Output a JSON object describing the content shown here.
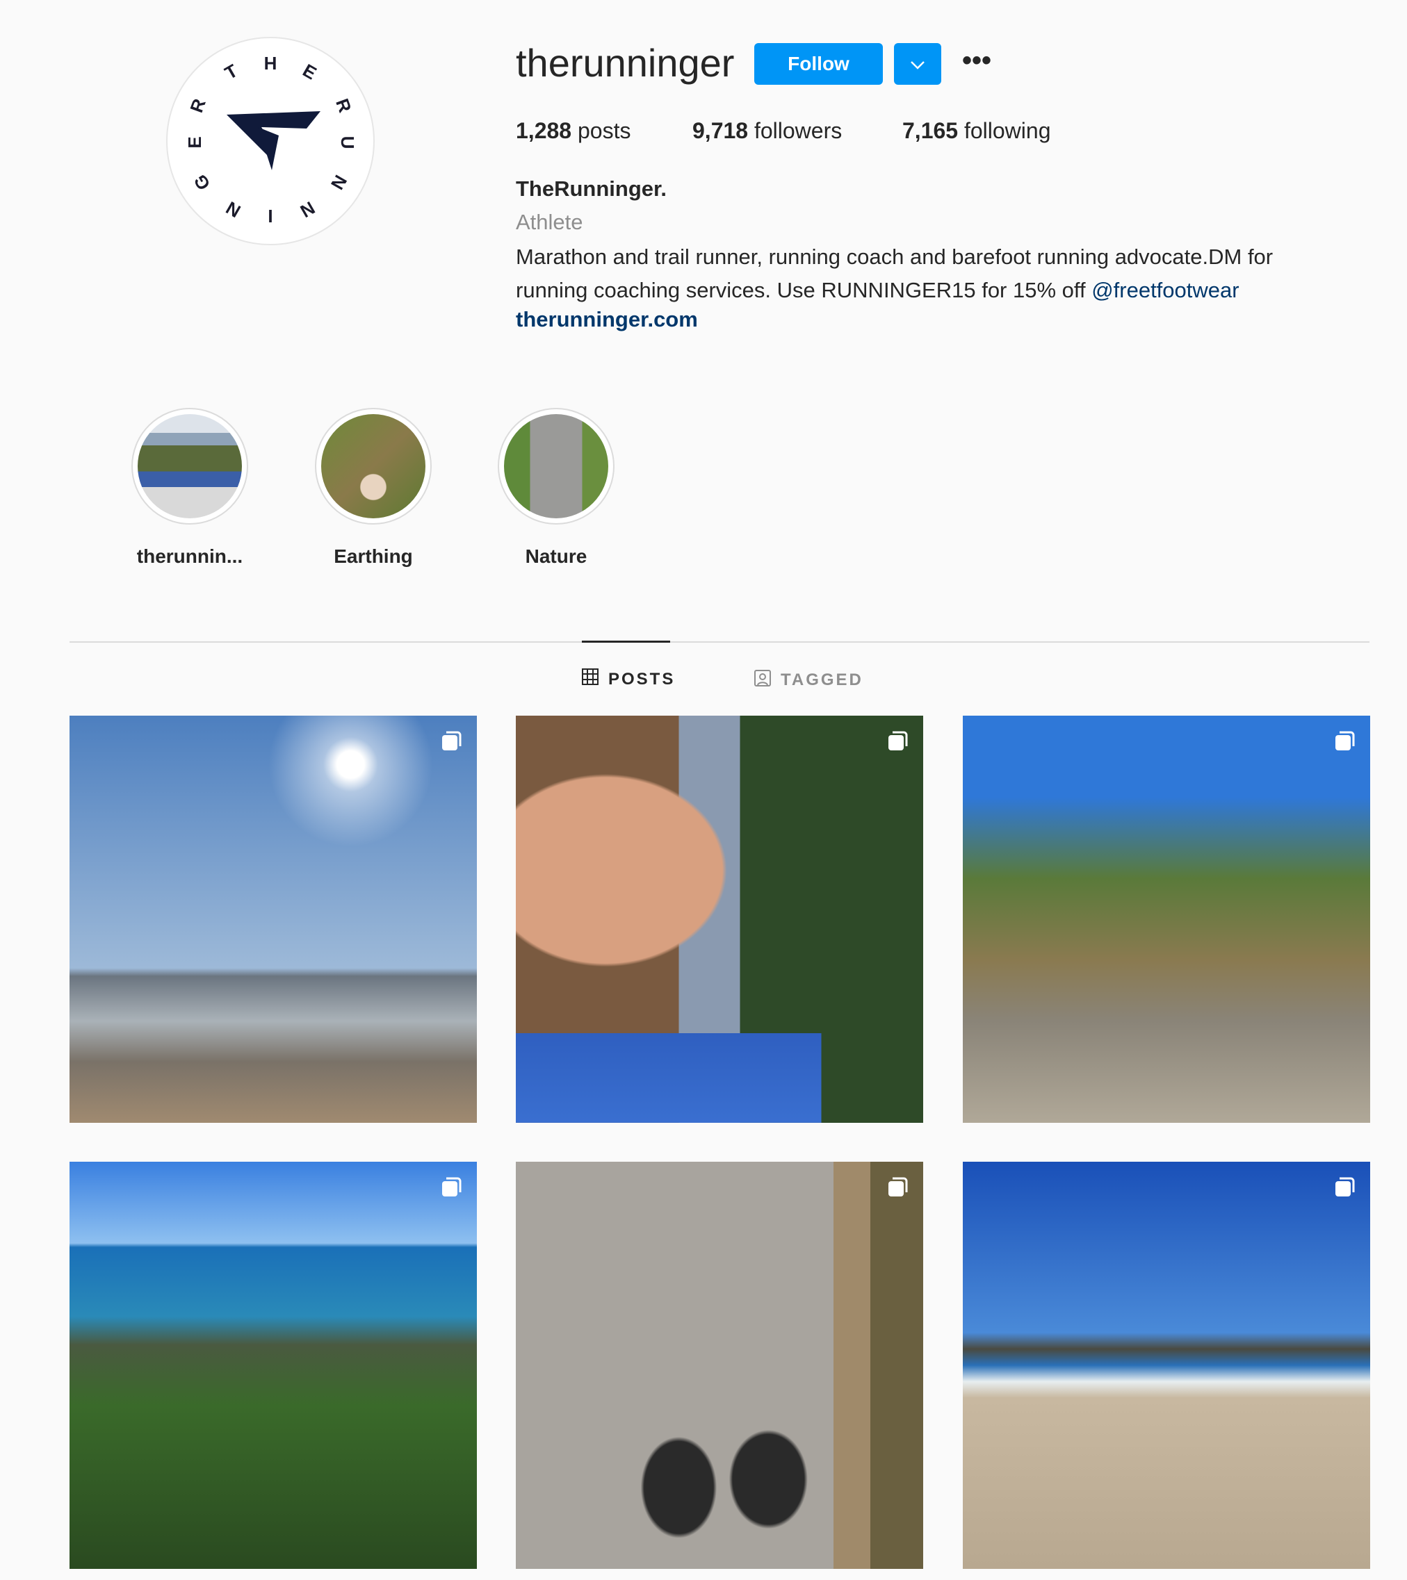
{
  "profile": {
    "username": "therunninger",
    "follow_label": "Follow",
    "posts_count": "1,288",
    "posts_label": "posts",
    "followers_count": "9,718",
    "followers_label": "followers",
    "following_count": "7,165",
    "following_label": "following",
    "display_name": "TheRunninger.",
    "category": "Athlete",
    "bio_text": "Marathon and trail runner, running coach and barefoot running advocate.DM for running coaching services. Use RUNNINGER15 for 15% off ",
    "bio_mention": "@freetfootwear",
    "website": "therunninger.com",
    "avatar_logo_text": "THE RUNNINGER"
  },
  "highlights": [
    {
      "label": "therunnin..."
    },
    {
      "label": "Earthing"
    },
    {
      "label": "Nature"
    }
  ],
  "tabs": [
    {
      "label": "POSTS",
      "icon": "grid-icon",
      "active": true
    },
    {
      "label": "TAGGED",
      "icon": "tagged-icon",
      "active": false
    }
  ],
  "posts": [
    {
      "subject": "beach-sun",
      "multi": true
    },
    {
      "subject": "selfie-coast",
      "multi": true
    },
    {
      "subject": "pandanus-rocks",
      "multi": true
    },
    {
      "subject": "ocean-headland",
      "multi": true
    },
    {
      "subject": "barefoot-shoes-start",
      "multi": true
    },
    {
      "subject": "beach-headland",
      "multi": true
    }
  ],
  "colors": {
    "accent": "#0095f6",
    "link": "#00376b"
  }
}
